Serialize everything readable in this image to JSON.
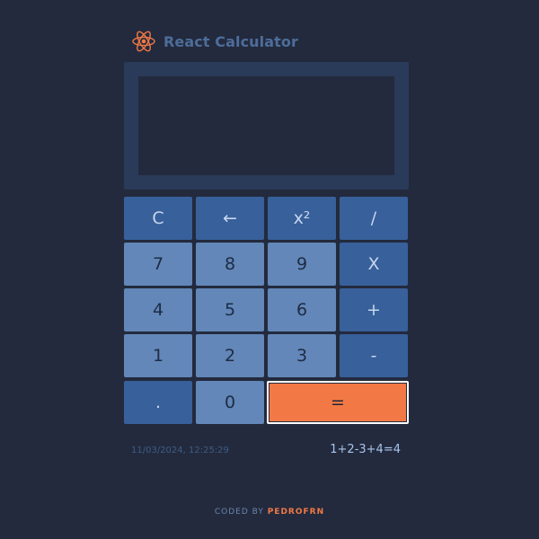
{
  "header": {
    "title": "React Calculator",
    "logo_icon": "react-atom-icon",
    "logo_color": "#f27945"
  },
  "display": {
    "value": ""
  },
  "keys": {
    "clear": "C",
    "backspace": "←",
    "square": "x²",
    "divide": "/",
    "seven": "7",
    "eight": "8",
    "nine": "9",
    "multiply": "X",
    "four": "4",
    "five": "5",
    "six": "6",
    "add": "+",
    "one": "1",
    "two": "2",
    "three": "3",
    "subtract": "-",
    "decimal": ".",
    "zero": "0",
    "equals": "="
  },
  "history": {
    "timestamp": "11/03/2024, 12:25:29",
    "expression": "1+2-3+4=4"
  },
  "footer": {
    "prefix": "CODED BY ",
    "author": "PEDROFRN"
  },
  "colors": {
    "background": "#232a3d",
    "function_key": "#38609a",
    "number_key": "#6287b8",
    "equals_key": "#f27945",
    "accent": "#f27945"
  }
}
